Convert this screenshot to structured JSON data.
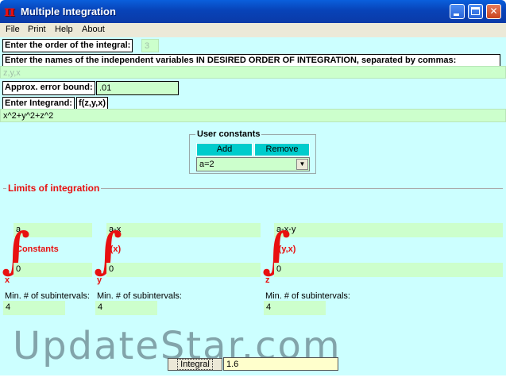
{
  "window": {
    "title": "Multiple Integration",
    "pi_symbol": "π"
  },
  "menu": [
    "File",
    "Print",
    "Help",
    "About"
  ],
  "order": {
    "label": "Enter the order of the integral:",
    "value": "3"
  },
  "variables": {
    "label": "Enter the names of the independent variables IN DESIRED ORDER OF INTEGRATION, separated by commas:",
    "value": "z,y,x"
  },
  "error_bound": {
    "label": "Approx. error bound:",
    "value": ".01"
  },
  "integrand": {
    "label": "Enter Integrand:",
    "fn": "f(z,y,x)",
    "value": "x^2+y^2+z^2"
  },
  "user_constants": {
    "title": "User constants",
    "add_label": "Add",
    "remove_label": "Remove",
    "selected": "a=2"
  },
  "limits": {
    "title": "Limits of integration",
    "columns": [
      {
        "upper": "a",
        "lower": "0",
        "func": "Constants",
        "var": "x",
        "sub_label": "Min. # of subintervals:",
        "sub_value": "4"
      },
      {
        "upper": "a-x",
        "lower": "0",
        "func": "f(x)",
        "var": "y",
        "sub_label": "Min. # of subintervals:",
        "sub_value": "4"
      },
      {
        "upper": "a-x-y",
        "lower": "0",
        "func": "f(y,x)",
        "var": "z",
        "sub_label": "Min. # of subintervals:",
        "sub_value": "4"
      }
    ]
  },
  "integral_button": "Integral",
  "result": "1.6",
  "watermark": "UpdateStar.com",
  "colors": {
    "panel": "#ccffff",
    "field": "#ccffcc",
    "accent_red": "#e81010",
    "button_teal": "#00cccc"
  }
}
